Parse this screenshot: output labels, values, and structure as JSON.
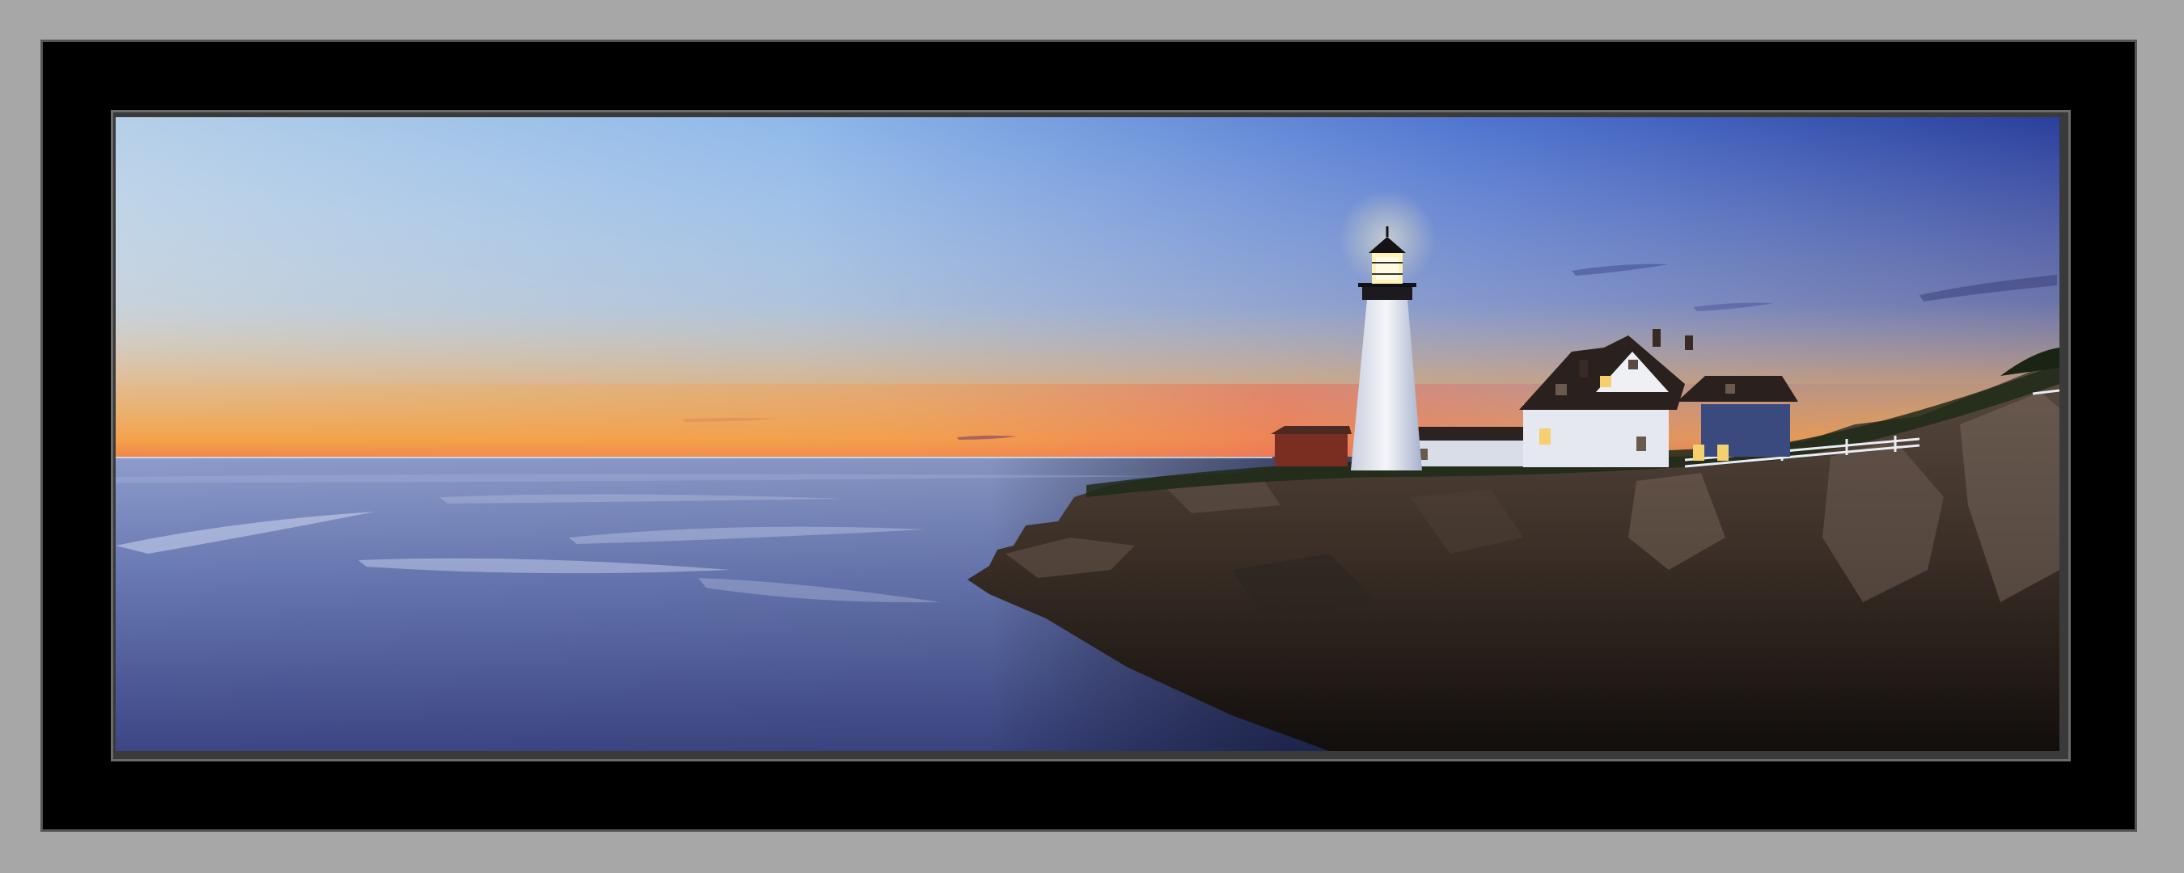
{
  "scene": {
    "subject": "lighthouse-on-rocky-coast",
    "time_of_day": "twilight",
    "colors": {
      "page_background": "#a7a7a7",
      "frame": "#000000",
      "frame_border": "#555555",
      "sky_top": "#2b4aa4",
      "sky_mid": "#8db4e6",
      "horizon_glow": "#f4a64a",
      "horizon_pink": "#e97a5a",
      "water": "#5f6ea8",
      "rocks": "#2b231d",
      "lighthouse": "#f1f3f8",
      "lantern_light": "#fff5c8"
    }
  }
}
